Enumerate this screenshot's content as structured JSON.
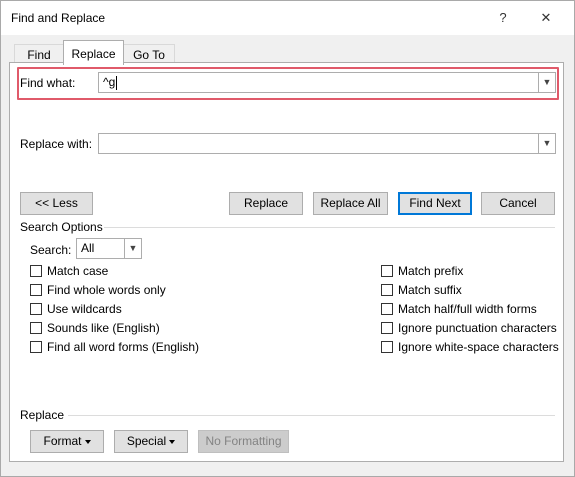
{
  "window": {
    "title": "Find and Replace",
    "help": "?",
    "close": "✕"
  },
  "tabs": [
    {
      "label": "Find"
    },
    {
      "label": "Replace"
    },
    {
      "label": "Go To"
    }
  ],
  "find": {
    "label": "Find what:",
    "value": "^g"
  },
  "replace": {
    "label": "Replace with:",
    "value": ""
  },
  "buttons": {
    "less": "<< Less",
    "replace": "Replace",
    "replace_all": "Replace All",
    "find_next": "Find Next",
    "cancel": "Cancel"
  },
  "search_options": {
    "heading": "Search Options",
    "search_label": "Search:",
    "search_value": "All",
    "left": [
      {
        "label": "Match case",
        "checked": false
      },
      {
        "label": "Find whole words only",
        "checked": false
      },
      {
        "label": "Use wildcards",
        "checked": false
      },
      {
        "label": "Sounds like (English)",
        "checked": false
      },
      {
        "label": "Find all word forms (English)",
        "checked": false
      }
    ],
    "right": [
      {
        "label": "Match prefix",
        "checked": false
      },
      {
        "label": "Match suffix",
        "checked": false
      },
      {
        "label": "Match half/full width forms",
        "checked": false
      },
      {
        "label": "Ignore punctuation characters",
        "checked": false
      },
      {
        "label": "Ignore white-space characters",
        "checked": false
      }
    ]
  },
  "replace_section": {
    "heading": "Replace",
    "format": "Format",
    "special": "Special",
    "no_formatting": "No Formatting"
  },
  "colors": {
    "highlight": "#e05a6a",
    "default_button": "#0078d7"
  }
}
